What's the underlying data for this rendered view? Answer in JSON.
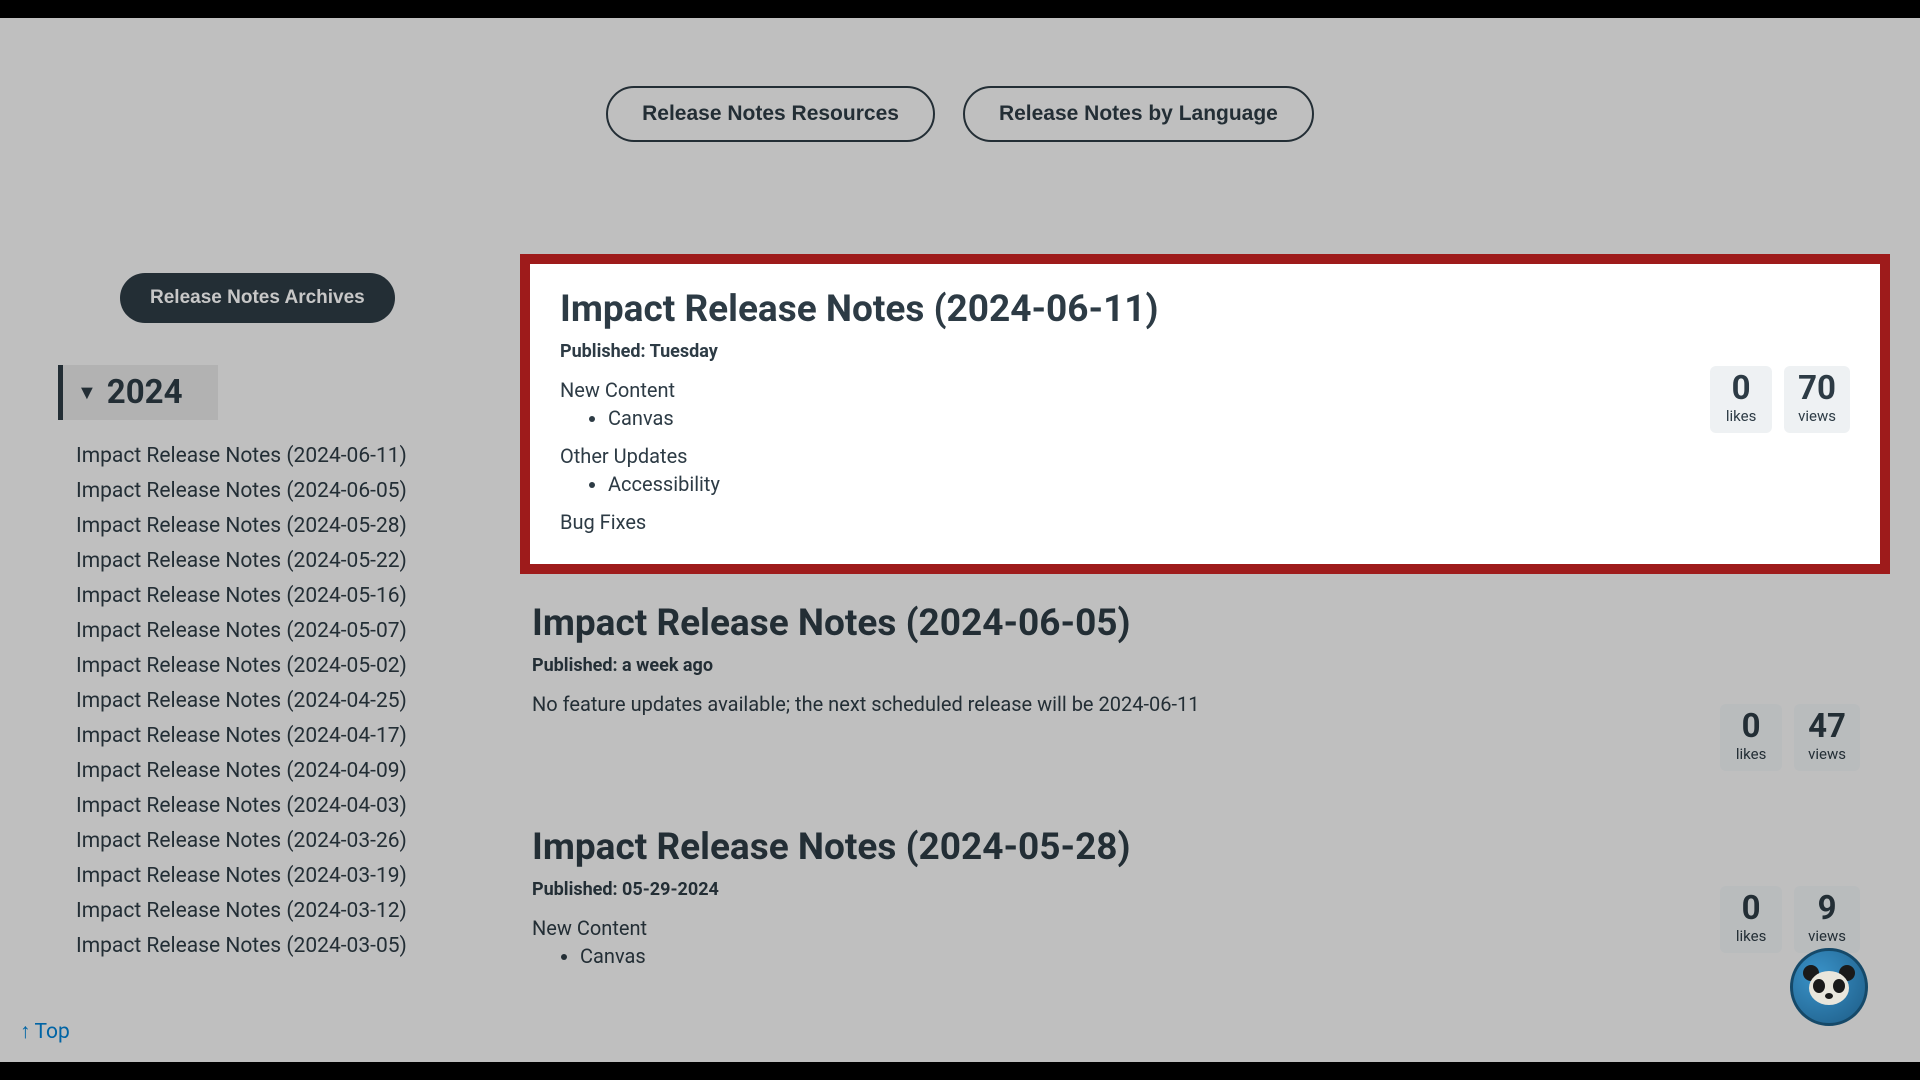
{
  "top_buttons": {
    "resources": "Release Notes Resources",
    "by_language": "Release Notes by Language"
  },
  "sidebar": {
    "archives_label": "Release Notes Archives",
    "year": "2024",
    "items": [
      "Impact Release Notes (2024-06-11)",
      "Impact Release Notes (2024-06-05)",
      "Impact Release Notes (2024-05-28)",
      "Impact Release Notes (2024-05-22)",
      "Impact Release Notes (2024-05-16)",
      "Impact Release Notes (2024-05-07)",
      "Impact Release Notes (2024-05-02)",
      "Impact Release Notes (2024-04-25)",
      "Impact Release Notes (2024-04-17)",
      "Impact Release Notes (2024-04-09)",
      "Impact Release Notes (2024-04-03)",
      "Impact Release Notes (2024-03-26)",
      "Impact Release Notes (2024-03-19)",
      "Impact Release Notes (2024-03-12)",
      "Impact Release Notes (2024-03-05)"
    ]
  },
  "releases": [
    {
      "title": "Impact Release Notes (2024-06-11)",
      "published": "Published: Tuesday",
      "sections": {
        "new_content": "New Content",
        "new_content_items": [
          "Canvas"
        ],
        "other_updates": "Other Updates",
        "other_updates_items": [
          "Accessibility"
        ],
        "bug_fixes": "Bug Fixes"
      },
      "likes": "0",
      "likes_label": "likes",
      "views": "70",
      "views_label": "views"
    },
    {
      "title": "Impact Release Notes (2024-06-05)",
      "published": "Published: a week ago",
      "body": "No feature updates available; the next scheduled release will be 2024-06-11",
      "likes": "0",
      "likes_label": "likes",
      "views": "47",
      "views_label": "views"
    },
    {
      "title": "Impact Release Notes (2024-05-28)",
      "published": "Published: 05-29-2024",
      "sections": {
        "new_content": "New Content",
        "new_content_items": [
          "Canvas"
        ]
      },
      "likes": "0",
      "likes_label": "likes",
      "views": "9",
      "views_label": "views"
    }
  ],
  "top_link": "Top",
  "labels": {
    "likes": "likes",
    "views": "views"
  }
}
